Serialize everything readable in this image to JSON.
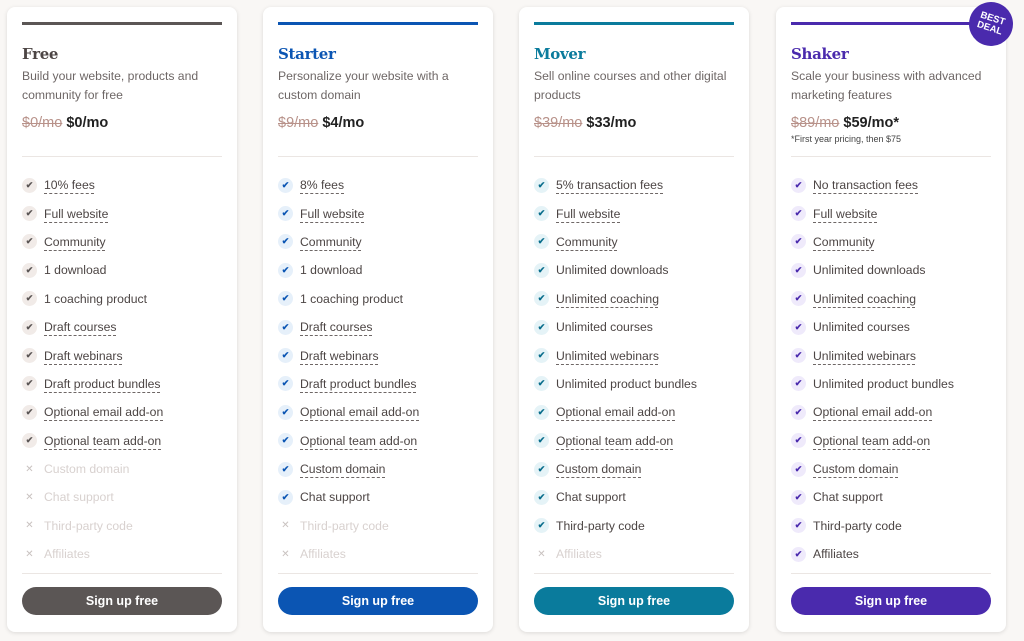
{
  "plans": [
    {
      "name": "Free",
      "description": "Build your website, products and community for free",
      "old_price": "$0/mo",
      "new_price": "$0/mo",
      "footnote": "",
      "accent": "#5b5655",
      "check_bg": "#f1ebe8",
      "check_color": "#5b5655",
      "cta": "Sign up free",
      "features": [
        {
          "label": "10% fees",
          "included": true,
          "tooltip": true
        },
        {
          "label": "Full website",
          "included": true,
          "tooltip": true
        },
        {
          "label": "Community",
          "included": true,
          "tooltip": true
        },
        {
          "label": "1 download",
          "included": true,
          "tooltip": false
        },
        {
          "label": "1 coaching product",
          "included": true,
          "tooltip": false
        },
        {
          "label": "Draft courses",
          "included": true,
          "tooltip": true
        },
        {
          "label": "Draft webinars",
          "included": true,
          "tooltip": true
        },
        {
          "label": "Draft product bundles",
          "included": true,
          "tooltip": true
        },
        {
          "label": "Optional email add-on",
          "included": true,
          "tooltip": true
        },
        {
          "label": "Optional team add-on",
          "included": true,
          "tooltip": true
        },
        {
          "label": "Custom domain",
          "included": false,
          "tooltip": false
        },
        {
          "label": "Chat support",
          "included": false,
          "tooltip": false
        },
        {
          "label": "Third-party code",
          "included": false,
          "tooltip": false
        },
        {
          "label": "Affiliates",
          "included": false,
          "tooltip": false
        }
      ]
    },
    {
      "name": "Starter",
      "description": "Personalize your website with a custom domain",
      "old_price": "$9/mo",
      "new_price": "$4/mo",
      "footnote": "",
      "accent": "#0b55b3",
      "check_bg": "#e6f0fa",
      "check_color": "#0b55b3",
      "cta": "Sign up free",
      "features": [
        {
          "label": "8% fees",
          "included": true,
          "tooltip": true
        },
        {
          "label": "Full website",
          "included": true,
          "tooltip": true
        },
        {
          "label": "Community",
          "included": true,
          "tooltip": true
        },
        {
          "label": "1 download",
          "included": true,
          "tooltip": false
        },
        {
          "label": "1 coaching product",
          "included": true,
          "tooltip": false
        },
        {
          "label": "Draft courses",
          "included": true,
          "tooltip": true
        },
        {
          "label": "Draft webinars",
          "included": true,
          "tooltip": true
        },
        {
          "label": "Draft product bundles",
          "included": true,
          "tooltip": true
        },
        {
          "label": "Optional email add-on",
          "included": true,
          "tooltip": true
        },
        {
          "label": "Optional team add-on",
          "included": true,
          "tooltip": true
        },
        {
          "label": "Custom domain",
          "included": true,
          "tooltip": true
        },
        {
          "label": "Chat support",
          "included": true,
          "tooltip": false
        },
        {
          "label": "Third-party code",
          "included": false,
          "tooltip": false
        },
        {
          "label": "Affiliates",
          "included": false,
          "tooltip": false
        }
      ]
    },
    {
      "name": "Mover",
      "description": "Sell online courses and other digital products",
      "old_price": "$39/mo",
      "new_price": "$33/mo",
      "footnote": "",
      "accent": "#0a7b9c",
      "check_bg": "#e5f3f7",
      "check_color": "#0a6e8c",
      "cta": "Sign up free",
      "features": [
        {
          "label": "5% transaction fees",
          "included": true,
          "tooltip": true
        },
        {
          "label": "Full website",
          "included": true,
          "tooltip": true
        },
        {
          "label": "Community",
          "included": true,
          "tooltip": true
        },
        {
          "label": "Unlimited downloads",
          "included": true,
          "tooltip": false
        },
        {
          "label": "Unlimited coaching",
          "included": true,
          "tooltip": true
        },
        {
          "label": "Unlimited courses",
          "included": true,
          "tooltip": false
        },
        {
          "label": "Unlimited webinars",
          "included": true,
          "tooltip": true
        },
        {
          "label": "Unlimited product bundles",
          "included": true,
          "tooltip": false
        },
        {
          "label": "Optional email add-on",
          "included": true,
          "tooltip": true
        },
        {
          "label": "Optional team add-on",
          "included": true,
          "tooltip": true
        },
        {
          "label": "Custom domain",
          "included": true,
          "tooltip": true
        },
        {
          "label": "Chat support",
          "included": true,
          "tooltip": false
        },
        {
          "label": "Third-party code",
          "included": true,
          "tooltip": false
        },
        {
          "label": "Affiliates",
          "included": false,
          "tooltip": false
        }
      ]
    },
    {
      "name": "Shaker",
      "description": "Scale your business with advanced marketing features",
      "old_price": "$89/mo",
      "new_price": "$59/mo*",
      "footnote": "*First year pricing, then $75",
      "accent": "#4a2aad",
      "check_bg": "#efeafb",
      "check_color": "#4a2aad",
      "cta": "Sign up free",
      "features": [
        {
          "label": "No transaction fees",
          "included": true,
          "tooltip": true
        },
        {
          "label": "Full website",
          "included": true,
          "tooltip": true
        },
        {
          "label": "Community",
          "included": true,
          "tooltip": true
        },
        {
          "label": "Unlimited downloads",
          "included": true,
          "tooltip": false
        },
        {
          "label": "Unlimited coaching",
          "included": true,
          "tooltip": true
        },
        {
          "label": "Unlimited courses",
          "included": true,
          "tooltip": false
        },
        {
          "label": "Unlimited webinars",
          "included": true,
          "tooltip": true
        },
        {
          "label": "Unlimited product bundles",
          "included": true,
          "tooltip": false
        },
        {
          "label": "Optional email add-on",
          "included": true,
          "tooltip": true
        },
        {
          "label": "Optional team add-on",
          "included": true,
          "tooltip": true
        },
        {
          "label": "Custom domain",
          "included": true,
          "tooltip": true
        },
        {
          "label": "Chat support",
          "included": true,
          "tooltip": false
        },
        {
          "label": "Third-party code",
          "included": true,
          "tooltip": false
        },
        {
          "label": "Affiliates",
          "included": true,
          "tooltip": false
        }
      ]
    }
  ],
  "badge": {
    "line1": "BEST",
    "line2": "DEAL"
  },
  "icons": {
    "check": "✔",
    "cross": "✕"
  }
}
